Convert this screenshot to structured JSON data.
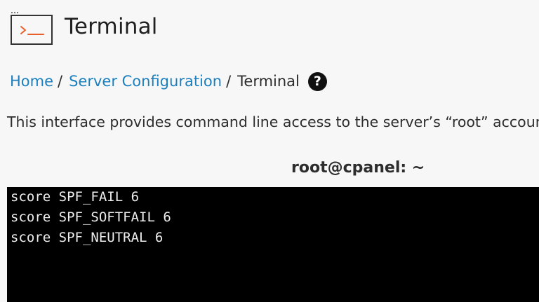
{
  "header": {
    "title": "Terminal",
    "icon": "terminal-icon",
    "icon_color": "#e8602c"
  },
  "breadcrumb": {
    "items": [
      {
        "label": "Home"
      },
      {
        "label": "Server Configuration"
      }
    ],
    "separator": "/",
    "current": "Terminal",
    "help_label": "?"
  },
  "description": "This interface provides command line access to the server’s “root” account.",
  "terminal": {
    "heading": "root@cpanel: ~",
    "background": "#000000",
    "lines": [
      "score SPF_FAIL 6",
      "score SPF_SOFTFAIL 6",
      "score SPF_NEUTRAL 6"
    ]
  },
  "colors": {
    "link": "#1d7fbe",
    "text": "#2d2d2d",
    "accent": "#e8602c"
  }
}
